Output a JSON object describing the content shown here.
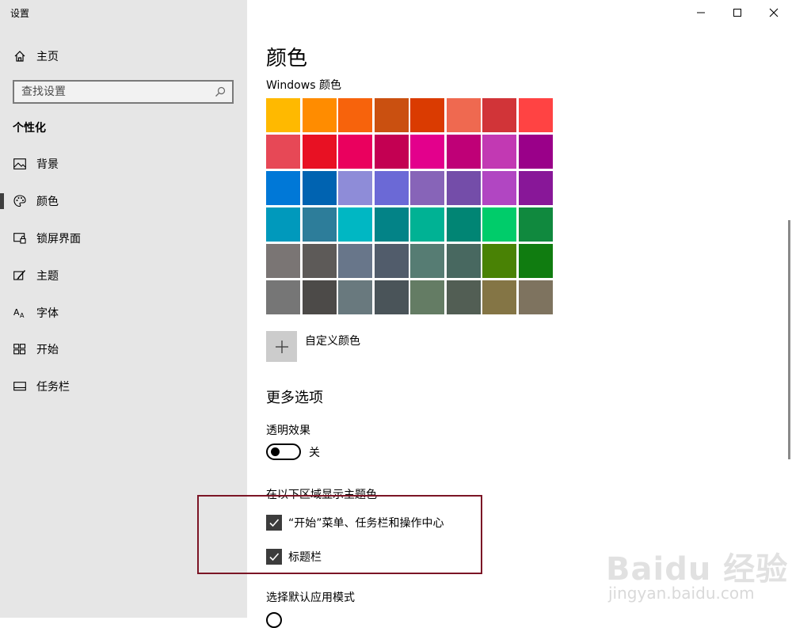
{
  "window": {
    "title": "设置"
  },
  "sidebar": {
    "home_label": "主页",
    "search_placeholder": "查找设置",
    "section": "个性化",
    "items": [
      {
        "label": "背景",
        "icon": "picture-icon"
      },
      {
        "label": "颜色",
        "icon": "palette-icon",
        "selected": true
      },
      {
        "label": "锁屏界面",
        "icon": "lock-screen-icon"
      },
      {
        "label": "主题",
        "icon": "theme-brush-icon"
      },
      {
        "label": "字体",
        "icon": "font-icon"
      },
      {
        "label": "开始",
        "icon": "start-tiles-icon"
      },
      {
        "label": "任务栏",
        "icon": "taskbar-icon"
      }
    ]
  },
  "main": {
    "title": "颜色",
    "windows_colors_label": "Windows 颜色",
    "palette": [
      "#FFB900",
      "#FF8C00",
      "#F7630C",
      "#CA5010",
      "#DA3B01",
      "#EF6950",
      "#D13438",
      "#FF4343",
      "#E74856",
      "#E81123",
      "#EA005E",
      "#C30052",
      "#E3008C",
      "#BF0077",
      "#C239B3",
      "#9A0089",
      "#0078D7",
      "#0063B1",
      "#8E8CD8",
      "#6B69D6",
      "#8764B8",
      "#744DA9",
      "#B146C2",
      "#881798",
      "#0099BC",
      "#2D7D9A",
      "#00B7C3",
      "#038387",
      "#00B294",
      "#018574",
      "#00CC6A",
      "#10893E",
      "#7A7574",
      "#5D5A58",
      "#68768A",
      "#515C6B",
      "#567C73",
      "#486860",
      "#498205",
      "#107C10",
      "#767676",
      "#4C4A48",
      "#69797E",
      "#4A5459",
      "#647C64",
      "#525E54",
      "#847545",
      "#7E735F"
    ],
    "custom_color_label": "自定义颜色",
    "more_options_heading": "更多选项",
    "transparency": {
      "label": "透明效果",
      "state_label": "关",
      "on": false
    },
    "accent_surfaces_label": "在以下区域显示主题色",
    "checkboxes": [
      {
        "label": "“开始”菜单、任务栏和操作中心",
        "checked": true
      },
      {
        "label": "标题栏",
        "checked": true
      }
    ],
    "app_mode_label": "选择默认应用模式"
  },
  "watermark": {
    "logo": "Baidu 经验",
    "url": "jingyan.baidu.com"
  },
  "colors": {
    "sidebar_bg": "#E6E6E6",
    "highlight_border": "#7B1525",
    "checkbox_fill": "#3C3C3C"
  }
}
